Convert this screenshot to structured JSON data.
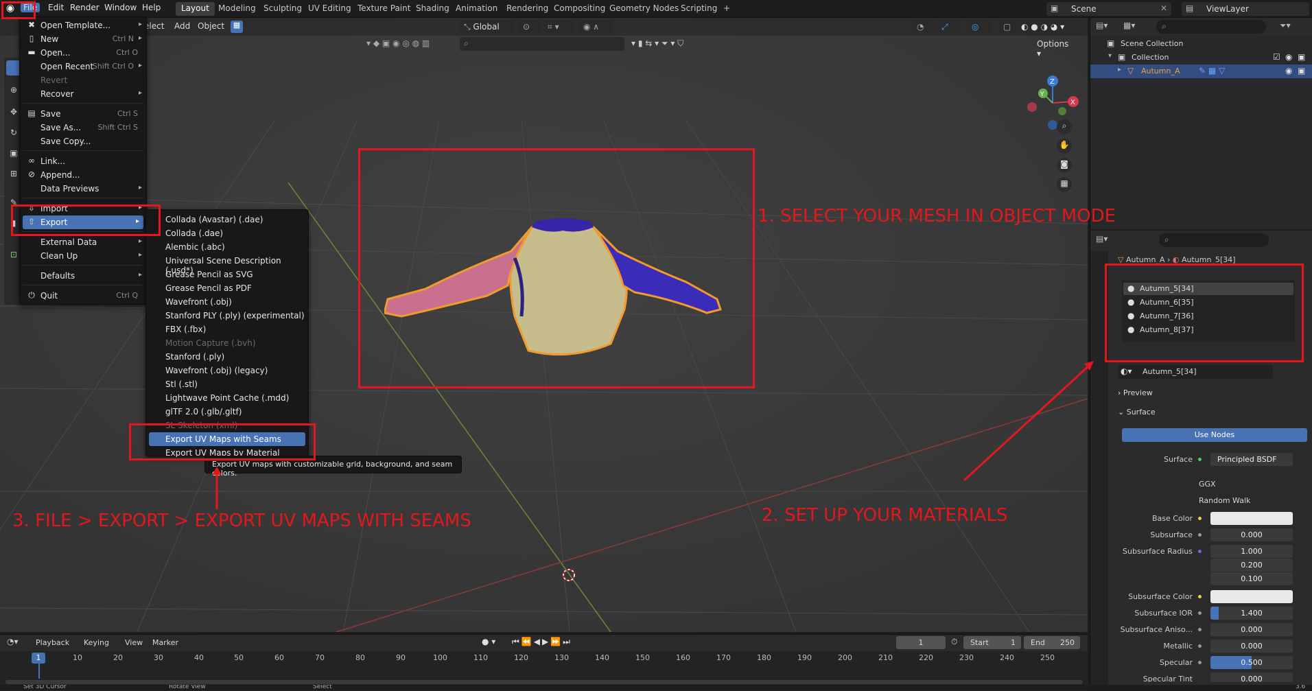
{
  "topbar": {
    "menus": [
      "File",
      "Edit",
      "Render",
      "Window",
      "Help"
    ],
    "workspaces": [
      "Layout",
      "Modeling",
      "Sculpting",
      "UV Editing",
      "Texture Paint",
      "Shading",
      "Animation",
      "Rendering",
      "Compositing",
      "Geometry Nodes",
      "Scripting"
    ],
    "active_workspace": "Layout",
    "add_tab": "+",
    "scene_label": "Scene",
    "view_layer_label": "ViewLayer"
  },
  "viewport_header": {
    "menus": [
      "Select",
      "Add",
      "Object"
    ],
    "select_visible": "elect",
    "orientation": "Global",
    "options_label": "Options"
  },
  "file_menu": {
    "items": [
      {
        "label": "Open Template...",
        "shortcut": "",
        "arrow": true,
        "icon": "file-template-icon"
      },
      {
        "label": "New",
        "shortcut": "Ctrl N",
        "arrow": true,
        "icon": "file-new-icon"
      },
      {
        "label": "Open...",
        "shortcut": "Ctrl O",
        "arrow": false,
        "icon": "folder-icon"
      },
      {
        "label": "Open Recent",
        "shortcut": "Shift Ctrl O",
        "arrow": true,
        "icon": ""
      },
      {
        "label": "Revert",
        "shortcut": "",
        "arrow": false,
        "icon": "",
        "disabled": true
      },
      {
        "label": "Recover",
        "shortcut": "",
        "arrow": true,
        "icon": ""
      },
      {
        "label": "Save",
        "shortcut": "Ctrl S",
        "arrow": false,
        "icon": "save-icon"
      },
      {
        "label": "Save As...",
        "shortcut": "Shift Ctrl S",
        "arrow": false,
        "icon": ""
      },
      {
        "label": "Save Copy...",
        "shortcut": "",
        "arrow": false,
        "icon": ""
      },
      {
        "label": "Link...",
        "shortcut": "",
        "arrow": false,
        "icon": "link-icon"
      },
      {
        "label": "Append...",
        "shortcut": "",
        "arrow": false,
        "icon": "append-icon"
      },
      {
        "label": "Data Previews",
        "shortcut": "",
        "arrow": true,
        "icon": ""
      },
      {
        "label": "Import",
        "shortcut": "",
        "arrow": true,
        "icon": "import-icon"
      },
      {
        "label": "Export",
        "shortcut": "",
        "arrow": true,
        "icon": "export-icon"
      },
      {
        "label": "External Data",
        "shortcut": "",
        "arrow": true,
        "icon": ""
      },
      {
        "label": "Clean Up",
        "shortcut": "",
        "arrow": true,
        "icon": ""
      },
      {
        "label": "Defaults",
        "shortcut": "",
        "arrow": true,
        "icon": ""
      },
      {
        "label": "Quit",
        "shortcut": "Ctrl Q",
        "arrow": false,
        "icon": "power-icon"
      }
    ]
  },
  "export_menu": {
    "items": [
      {
        "label": "Collada (Avastar) (.dae)"
      },
      {
        "label": "Collada (.dae)"
      },
      {
        "label": "Alembic (.abc)"
      },
      {
        "label": "Universal Scene Description (.usd*)"
      },
      {
        "label": "Grease Pencil as SVG"
      },
      {
        "label": "Grease Pencil as PDF"
      },
      {
        "label": "Wavefront (.obj)"
      },
      {
        "label": "Stanford PLY (.ply) (experimental)"
      },
      {
        "label": "FBX (.fbx)"
      },
      {
        "label": "Motion Capture (.bvh)",
        "disabled": true
      },
      {
        "label": "Stanford (.ply)"
      },
      {
        "label": "Wavefront (.obj) (legacy)"
      },
      {
        "label": "Stl (.stl)"
      },
      {
        "label": "Lightwave Point Cache (.mdd)"
      },
      {
        "label": "glTF 2.0 (.glb/.gltf)"
      },
      {
        "label": "SL Skeleton (xml)",
        "disabled": true
      },
      {
        "label": "Export UV Maps with Seams",
        "highlight": true
      },
      {
        "label": "Export UV Maps by Material"
      }
    ],
    "tooltip": "Export UV maps with customizable grid, background, and seam colors."
  },
  "annotations": {
    "step1": "1. SELECT YOUR MESH IN OBJECT MODE",
    "step2": "2. SET UP YOUR MATERIALS",
    "step3": "3. FILE > EXPORT > EXPORT UV MAPS WITH SEAMS",
    "color": "#e3181e"
  },
  "outliner": {
    "scene_collection": "Scene Collection",
    "collection": "Collection",
    "object": "Autumn_A"
  },
  "properties": {
    "breadcrumb_object": "Autumn_A",
    "breadcrumb_material": "Autumn_5[34]",
    "material_slots": [
      "Autumn_5[34]",
      "Autumn_6[35]",
      "Autumn_7[36]",
      "Autumn_8[37]"
    ],
    "active_material": "Autumn_5[34]",
    "preview_label": "Preview",
    "surface_label": "Surface",
    "use_nodes": "Use Nodes",
    "surface_shader_label": "Surface",
    "surface_shader": "Principled BSDF",
    "distribution": "GGX",
    "subsurface_method": "Random Walk",
    "fields": [
      {
        "label": "Base Color",
        "value": "",
        "type": "color"
      },
      {
        "label": "Subsurface",
        "value": "0.000"
      },
      {
        "label": "Subsurface Radius",
        "value": "1.000"
      },
      {
        "label": "",
        "value": "0.200"
      },
      {
        "label": "",
        "value": "0.100"
      },
      {
        "label": "Subsurface Color",
        "value": "",
        "type": "color"
      },
      {
        "label": "Subsurface IOR",
        "value": "1.400"
      },
      {
        "label": "Subsurface Aniso...",
        "value": "0.000"
      },
      {
        "label": "Metallic",
        "value": "0.000"
      },
      {
        "label": "Specular",
        "value": "0.500",
        "type": "blue"
      },
      {
        "label": "Specular Tint",
        "value": "0.000"
      }
    ]
  },
  "timeline": {
    "menus": [
      "Playback",
      "Keying",
      "View",
      "Marker"
    ],
    "current_frame": "1",
    "start_label": "Start",
    "start": "1",
    "end_label": "End",
    "end": "250",
    "ticks": [
      "1",
      "10",
      "20",
      "30",
      "40",
      "50",
      "60",
      "70",
      "80",
      "90",
      "100",
      "110",
      "120",
      "130",
      "140",
      "150",
      "160",
      "170",
      "180",
      "190",
      "200",
      "210",
      "220",
      "230",
      "240",
      "250"
    ]
  },
  "statusbar": {
    "items": [
      "Set 3D Cursor",
      "Rotate View",
      "Select"
    ],
    "version": "3.6"
  }
}
